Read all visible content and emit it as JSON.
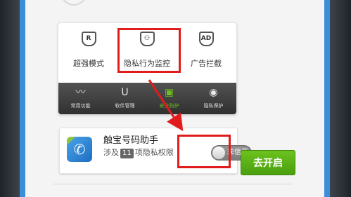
{
  "features": [
    {
      "label": "超强模式",
      "icon": "shield-r-icon",
      "glyph": "R"
    },
    {
      "label": "隐私行为监控",
      "icon": "person-shield-icon",
      "glyph": "⚇"
    },
    {
      "label": "广告拦截",
      "icon": "ad-shield-icon",
      "glyph": "AD"
    }
  ],
  "nav": [
    {
      "label": "常用功能",
      "icon": "pulse-icon",
      "glyph": "〰"
    },
    {
      "label": "软件管理",
      "icon": "bag-icon",
      "glyph": "U"
    },
    {
      "label": "安全防护",
      "icon": "toolbox-icon",
      "glyph": "▣"
    },
    {
      "label": "隐私保护",
      "icon": "person-icon",
      "glyph": "◉"
    }
  ],
  "app": {
    "name": "触宝号码助手",
    "desc_prefix": "涉及",
    "count": "11",
    "desc_suffix": "项隐私权限",
    "icon": "phone-icon",
    "glyph": "✆"
  },
  "toggle_label": "未信任",
  "open_button": "去开启",
  "colors": {
    "highlight": "#e01c1c",
    "accent_green": "#5ab016",
    "screen_edge": "#3a8fd8"
  }
}
